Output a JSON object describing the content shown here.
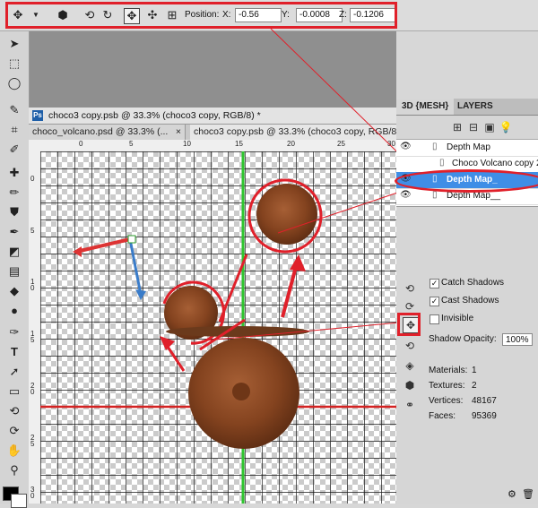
{
  "options_bar": {
    "position_label": "Position:",
    "x_label": "X:",
    "x_value": "-0.56",
    "y_label": "Y:",
    "y_value": "-0.0008",
    "z_label": "Z:",
    "z_value": "-0.1206",
    "icons": [
      "3d-move-tool-icon",
      "dropdown-arrow-icon",
      "home-cube-icon",
      "3d-rotate-icon",
      "3d-roll-icon",
      "3d-pan-icon",
      "3d-slide-icon",
      "3d-scale-icon"
    ]
  },
  "document": {
    "title": "choco3 copy.psb @ 33.3% (choco3 copy, RGB/8) *",
    "tabs": [
      {
        "label": "choco_volcano.psd @ 33.3% (...",
        "close": "×"
      },
      {
        "label": "choco3 copy.psb @ 33.3% (choco3 copy, RGB/8",
        "close": ""
      }
    ],
    "ruler_top": [
      "0",
      "5",
      "10",
      "15",
      "20",
      "25",
      "30"
    ],
    "ruler_left": [
      "0",
      "5",
      "1\n0",
      "1\n5",
      "2\n0",
      "2\n5",
      "3\n0"
    ]
  },
  "panel": {
    "tabs": [
      "3D {MESH}",
      "LAYERS"
    ],
    "layers": [
      {
        "name": "Depth Map",
        "selected": false,
        "eye": true
      },
      {
        "name": "Choco Volcano copy 2",
        "selected": false,
        "eye": false
      },
      {
        "name": "Depth Map_",
        "selected": true,
        "eye": true
      },
      {
        "name": "Depth Map__",
        "selected": false,
        "eye": true
      }
    ],
    "properties": {
      "catch_shadows": {
        "label": "Catch Shadows",
        "checked": true
      },
      "cast_shadows": {
        "label": "Cast Shadows",
        "checked": true
      },
      "invisible": {
        "label": "Invisible",
        "checked": false
      },
      "shadow_opacity_label": "Shadow Opacity:",
      "shadow_opacity_value": "100%",
      "materials_label": "Materials:",
      "materials_value": "1",
      "textures_label": "Textures:",
      "textures_value": "2",
      "vertices_label": "Vertices:",
      "vertices_value": "48167",
      "faces_label": "Faces:",
      "faces_value": "95369"
    }
  },
  "colors": {
    "highlight_red": "#e0202a",
    "selection_blue": "#3f8ee6",
    "guide_green": "#2ec52e",
    "guide_red": "#d42222",
    "chocolate": "#8a4a26"
  }
}
